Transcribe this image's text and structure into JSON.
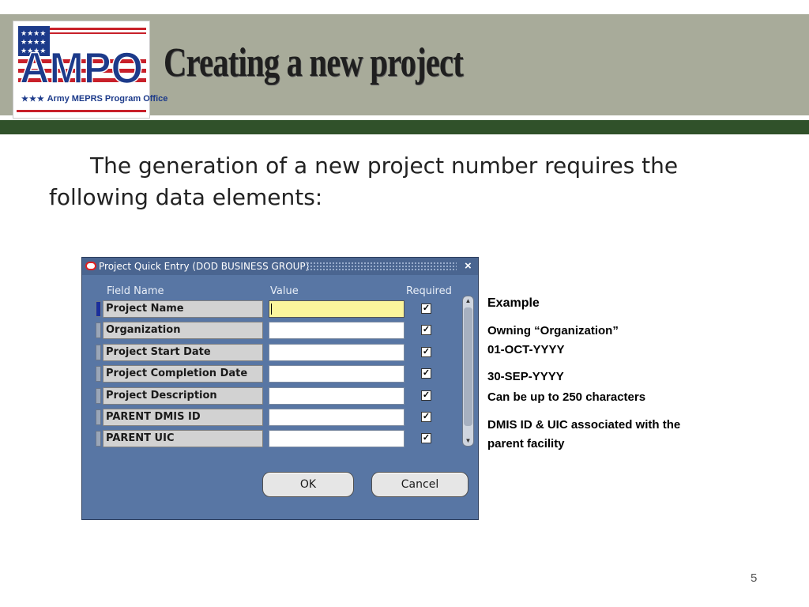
{
  "slide": {
    "title": "Creating a new project",
    "intro": "The generation of a new project number requires the following data elements:",
    "page_number": "5"
  },
  "logo": {
    "letters": "AMPO",
    "text": "Army MEPRS Program Office",
    "stars": "★★★"
  },
  "window": {
    "title": "Project Quick Entry (DOD BUSINESS GROUP)",
    "close_label": "×",
    "col_field_name": "Field Name",
    "col_value": "Value",
    "col_required": "Required",
    "rows": [
      {
        "label": "Project Name",
        "value": "",
        "required": true,
        "focused": true
      },
      {
        "label": "Organization",
        "value": "",
        "required": true
      },
      {
        "label": "Project Start Date",
        "value": "",
        "required": true
      },
      {
        "label": "Project Completion Date",
        "value": "",
        "required": true
      },
      {
        "label": "Project Description",
        "value": "",
        "required": true
      },
      {
        "label": "PARENT DMIS ID",
        "value": "",
        "required": true
      },
      {
        "label": "PARENT UIC",
        "value": "",
        "required": true
      }
    ],
    "ok_label": "OK",
    "cancel_label": "Cancel",
    "check_glyph": "✓"
  },
  "example": {
    "heading": "Example",
    "line1": "Owning “Organization”",
    "line2": "01-OCT-YYYY",
    "line3": "30-SEP-YYYY",
    "line4": "Can be up to 250 characters",
    "line5": "DMIS ID & UIC associated with the",
    "line6": "parent facility"
  },
  "colors": {
    "header_gray": "#a8ab9a",
    "header_green": "#30512a",
    "window_bg": "#5876a4",
    "focused_field": "#fbf59c"
  }
}
